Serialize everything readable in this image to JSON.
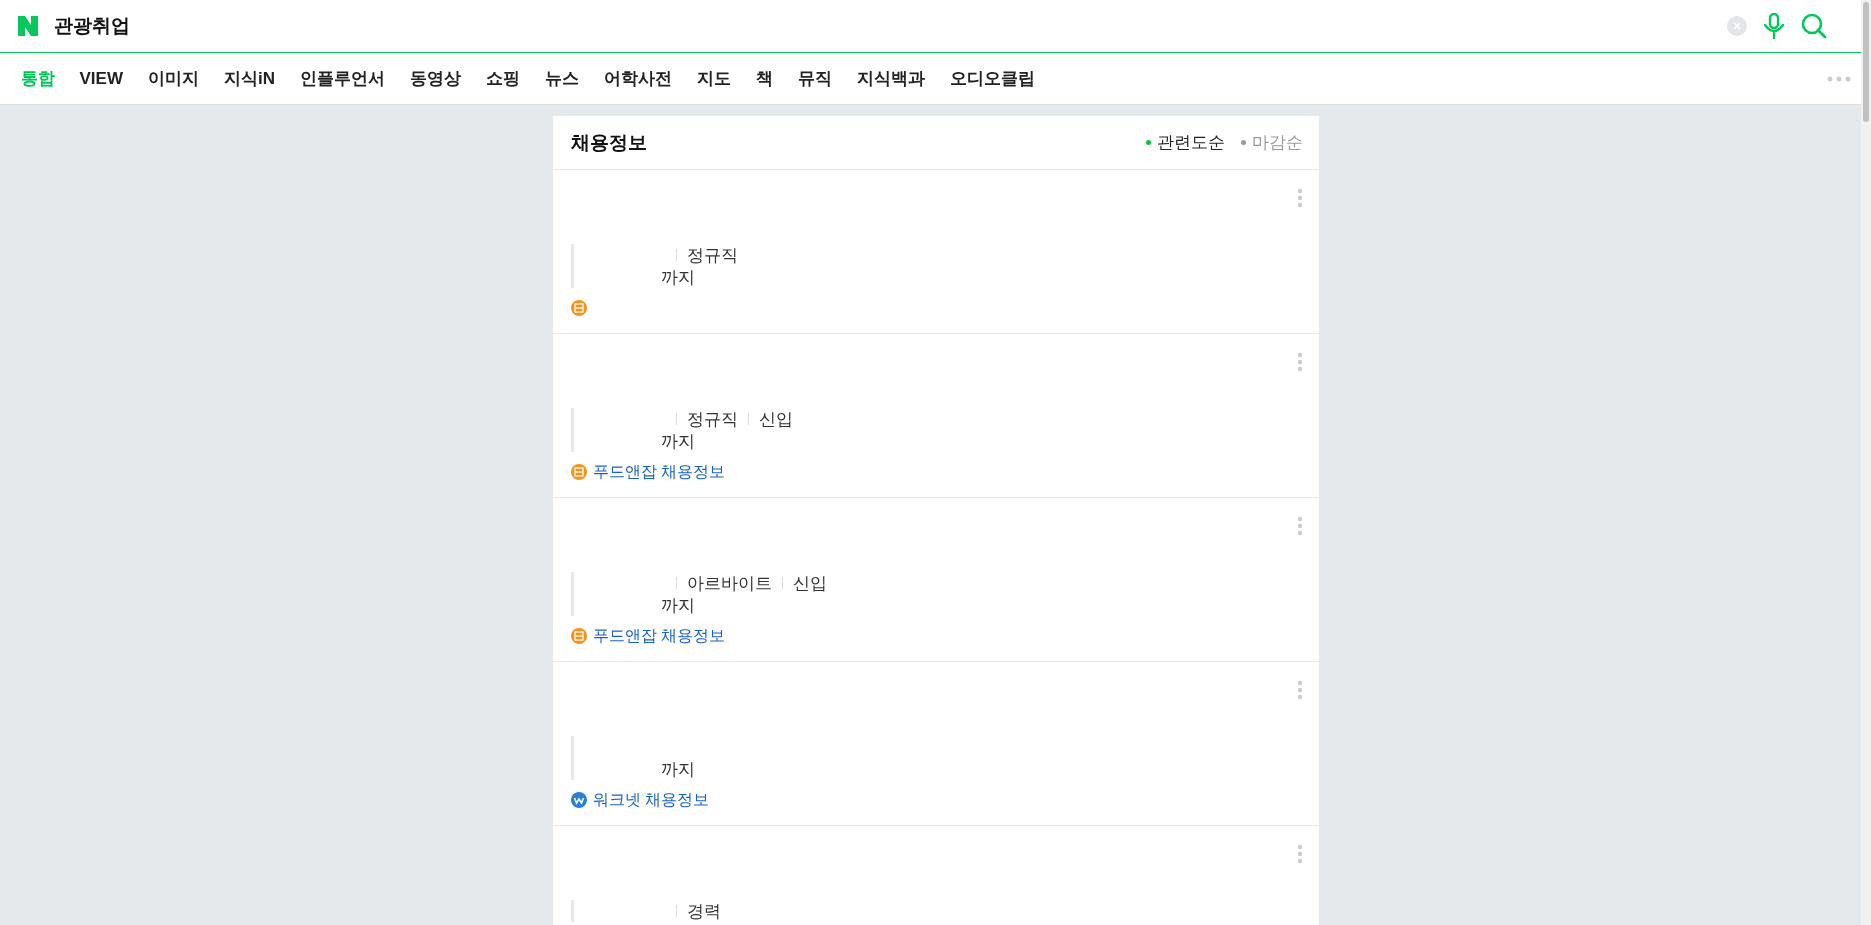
{
  "search": {
    "query": "관광취업"
  },
  "tabs": [
    {
      "label": "통합",
      "selected": true
    },
    {
      "label": "VIEW",
      "selected": false
    },
    {
      "label": "이미지",
      "selected": false
    },
    {
      "label": "지식iN",
      "selected": false
    },
    {
      "label": "인플루언서",
      "selected": false
    },
    {
      "label": "동영상",
      "selected": false
    },
    {
      "label": "쇼핑",
      "selected": false
    },
    {
      "label": "뉴스",
      "selected": false
    },
    {
      "label": "어학사전",
      "selected": false
    },
    {
      "label": "지도",
      "selected": false
    },
    {
      "label": "책",
      "selected": false
    },
    {
      "label": "뮤직",
      "selected": false
    },
    {
      "label": "지식백과",
      "selected": false
    },
    {
      "label": "오디오클립",
      "selected": false
    }
  ],
  "section": {
    "title": "채용정보",
    "sort_options": [
      {
        "label": "관련도순",
        "selected": true
      },
      {
        "label": "마감순",
        "selected": false
      }
    ],
    "jobs": [
      {
        "tags": [
          "정규직"
        ],
        "deadline": "까지",
        "source": {
          "kind": "foodnjob"
        }
      },
      {
        "tags": [
          "정규직",
          "신입"
        ],
        "deadline": "까지",
        "source": {
          "kind": "foodnjob",
          "label": "푸드앤잡 채용정보"
        }
      },
      {
        "tags": [
          "아르바이트",
          "신입"
        ],
        "deadline": "까지",
        "source": {
          "kind": "foodnjob",
          "label": "푸드앤잡 채용정보"
        }
      },
      {
        "deadline": "까지",
        "source": {
          "kind": "worknet",
          "label": "워크넷 채용정보"
        }
      },
      {
        "tags": [
          "경력"
        ]
      }
    ]
  }
}
